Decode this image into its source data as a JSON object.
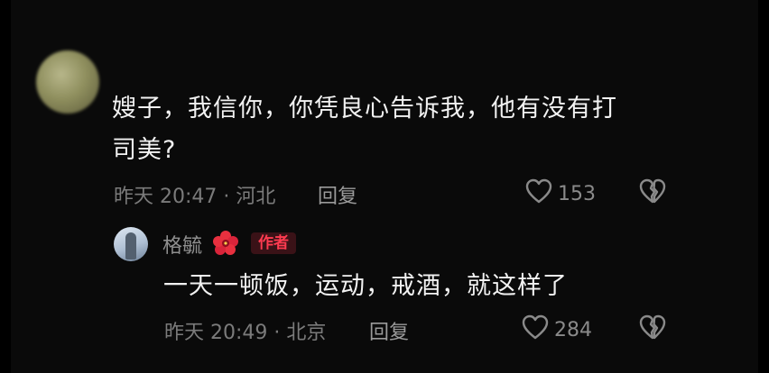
{
  "comment": {
    "line1": "嫂子，我信你，你凭良心告诉我，他有没有打",
    "line2": "司美?",
    "meta": "昨天 20:47 · 河北",
    "reply_label": "回复",
    "likes": "153"
  },
  "reply": {
    "username": "格毓",
    "badge": "作者",
    "text": "一天一顿饭，运动，戒酒，就这样了",
    "meta": "昨天 20:49 · 北京",
    "reply_label": "回复",
    "likes": "284"
  },
  "icons": {
    "like": "heart-outline-icon",
    "dislike": "broken-heart-icon",
    "flower": "hibiscus-icon"
  },
  "colors": {
    "background": "#000000",
    "text": "#f2f2f2",
    "meta": "#7b7b7b",
    "badge_text": "#ff3b50",
    "badge_bg": "#3a1217"
  }
}
